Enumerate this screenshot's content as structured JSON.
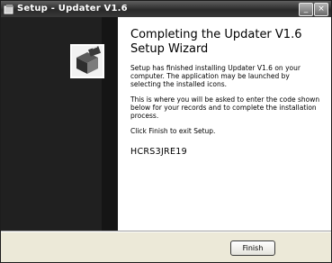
{
  "window": {
    "title": "Setup - Updater V1.6",
    "minimize_glyph": "_",
    "close_glyph": "×"
  },
  "wizard": {
    "heading": "Completing the Updater V1.6 Setup Wizard",
    "paragraph1": "Setup has finished installing Updater V1.6 on your computer. The application may be launched by selecting the installed icons.",
    "paragraph2": "This is where you will be asked to enter the code shown below for your records and to complete the installation process.",
    "paragraph3": "Click Finish to exit Setup.",
    "code": "HCRS3JRE19"
  },
  "buttons": {
    "finish": "Finish"
  },
  "icons": {
    "title": "setup-app-icon",
    "banner": "setup-box-icon"
  },
  "colors": {
    "banner": "#202020",
    "content": "#ffffff",
    "footer": "#ece9d8"
  }
}
